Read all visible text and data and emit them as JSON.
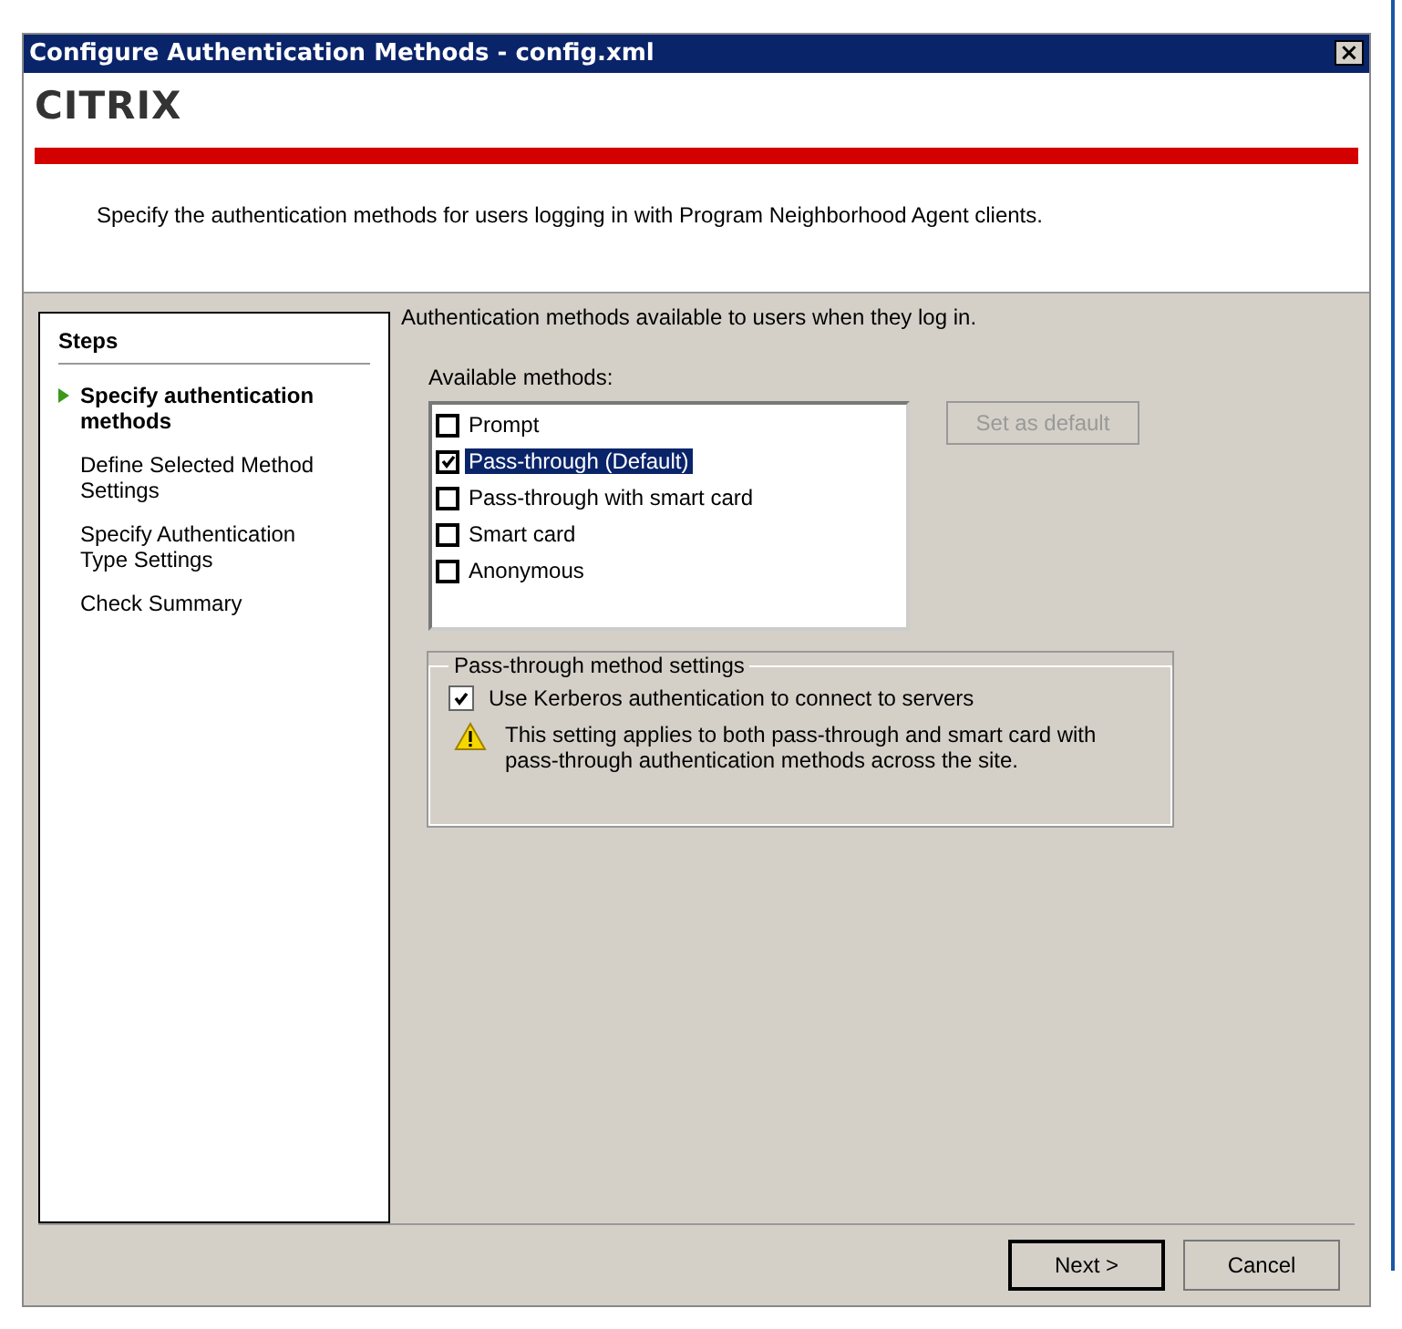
{
  "window": {
    "title": "Configure Authentication Methods - config.xml",
    "close": "×"
  },
  "logo": "CITRIX",
  "header_text": "Specify the authentication methods for users logging in with Program Neighborhood Agent clients.",
  "steps": {
    "title": "Steps",
    "items": [
      {
        "label": "Specify authentication methods",
        "selected": true
      },
      {
        "label": "Define Selected Method Settings",
        "selected": false
      },
      {
        "label": "Specify Authentication Type Settings",
        "selected": false
      },
      {
        "label": "Check Summary",
        "selected": false
      }
    ]
  },
  "intro": "Authentication methods available to users when they log in.",
  "methods_label": "Available methods:",
  "methods": [
    {
      "label": "Prompt",
      "checked": false,
      "selected": false
    },
    {
      "label": "Pass-through (Default)",
      "checked": true,
      "selected": true
    },
    {
      "label": "Pass-through with smart card",
      "checked": false,
      "selected": false
    },
    {
      "label": "Smart card",
      "checked": false,
      "selected": false
    },
    {
      "label": "Anonymous",
      "checked": false,
      "selected": false
    }
  ],
  "set_default": {
    "label": "Set as default",
    "disabled": true
  },
  "passthrough": {
    "title": "Pass-through method settings",
    "kerberos": {
      "label": "Use Kerberos authentication to connect to servers",
      "checked": true
    },
    "warning": "This setting applies to both pass-through and smart card with pass-through authentication methods across the site."
  },
  "buttons": [
    {
      "label": "Next >",
      "kind": "default"
    },
    {
      "label": "Cancel",
      "kind": "normal"
    }
  ]
}
